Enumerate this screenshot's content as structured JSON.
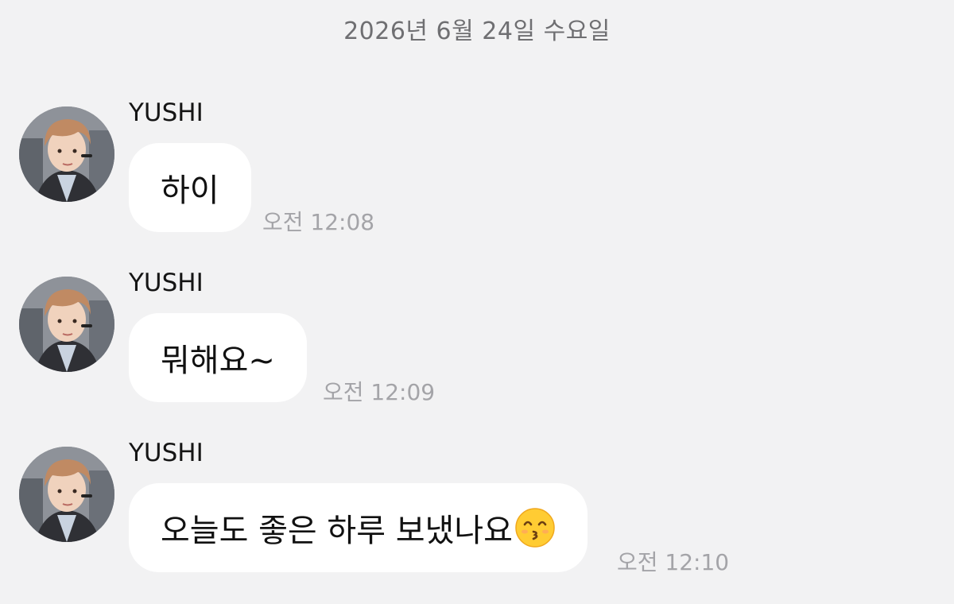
{
  "date_divider": "2026년 6월 24일 수요일",
  "messages": [
    {
      "sender": "YUSHI",
      "text": "하이",
      "time": "오전 12:08"
    },
    {
      "sender": "YUSHI",
      "text": "뭐해요~",
      "time": "오전 12:09"
    },
    {
      "sender": "YUSHI",
      "text": "오늘도 좋은 하루 보냈나요",
      "time": "오전 12:10",
      "emoji": "kissing-smiling-eyes-emoji"
    }
  ]
}
